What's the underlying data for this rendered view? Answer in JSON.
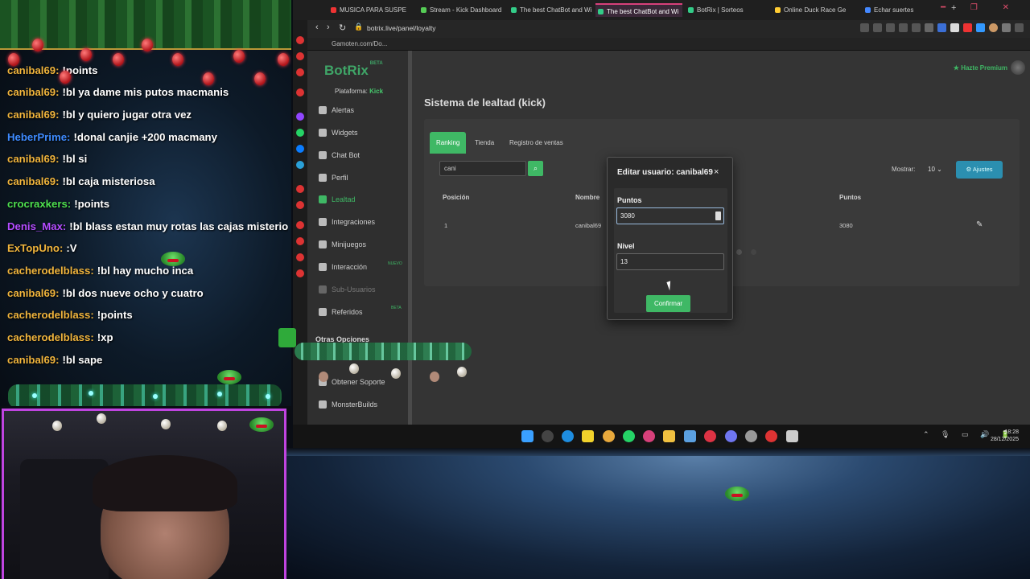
{
  "chat": {
    "lines": [
      {
        "user": "",
        "text": "",
        "color": "#ff5c5c"
      },
      {
        "user": "canibal69:",
        "text": "!points",
        "color": "#f0b43c"
      },
      {
        "user": "canibal69:",
        "text": "!bl ya dame mis putos macmanis",
        "color": "#f0b43c"
      },
      {
        "user": "canibal69:",
        "text": "!bl y quiero jugar otra vez",
        "color": "#f0b43c"
      },
      {
        "user": "HeberPrime:",
        "text": "!donal canjie +200 macmany",
        "color": "#3e8bff"
      },
      {
        "user": "canibal69:",
        "text": "!bl si",
        "color": "#f0b43c"
      },
      {
        "user": "canibal69:",
        "text": "!bl caja misteriosa",
        "color": "#f0b43c"
      },
      {
        "user": "crocraxkers:",
        "text": "!points",
        "color": "#4ee04e"
      },
      {
        "user": "Denis_Max:",
        "text": "!bl blass estan muy rotas las cajas misteriosas",
        "color": "#b44cff"
      },
      {
        "user": "ExTopUno:",
        "text": ":V",
        "color": "#f0b43c"
      },
      {
        "user": "cacherodelblass:",
        "text": "!bl hay mucho inca",
        "color": "#f0b43c"
      },
      {
        "user": "canibal69:",
        "text": "!bl dos nueve ocho y cuatro",
        "color": "#f0b43c"
      },
      {
        "user": "cacherodelblass:",
        "text": "!points",
        "color": "#f0b43c"
      },
      {
        "user": "cacherodelblass:",
        "text": "!xp",
        "color": "#f0b43c"
      },
      {
        "user": "canibal69:",
        "text": "!bl sape",
        "color": "#f0b43c"
      }
    ]
  },
  "browser": {
    "tabs": [
      {
        "label": "MUSICA PARA SUSPE",
        "icon_color": "#e33"
      },
      {
        "label": "Stream - Kick Dashboard",
        "icon_color": "#5c5"
      },
      {
        "label": "The best ChatBot and Wi",
        "icon_color": "#3c8"
      },
      {
        "label": "The best ChatBot and Wi",
        "icon_color": "#3c8"
      },
      {
        "label": "BotRix | Sorteos",
        "icon_color": "#3c8"
      },
      {
        "label": "Online Duck Race Ge",
        "icon_color": "#fc3"
      },
      {
        "label": "Echar suertes",
        "icon_color": "#48f"
      }
    ],
    "new_tab": "+",
    "window_controls": "━ ❐ ✕",
    "url": "botrix.live/panel/loyalty",
    "bookmark": "Gamoten.com/Do...",
    "nav_back": "‹",
    "nav_forward": "›",
    "nav_reload": "↻"
  },
  "app": {
    "logo": "BotRix",
    "logo_tag": "BETA",
    "platform_label": "Plataforma:",
    "platform_value": "Kick",
    "premium": "★ Hazte Premium",
    "nav": [
      {
        "label": "Alertas",
        "state": "normal"
      },
      {
        "label": "Widgets",
        "state": "normal"
      },
      {
        "label": "Chat Bot",
        "state": "normal"
      },
      {
        "label": "Perfil",
        "state": "normal"
      },
      {
        "label": "Lealtad",
        "state": "active"
      },
      {
        "label": "Integraciones",
        "state": "normal"
      },
      {
        "label": "Minijuegos",
        "state": "normal"
      },
      {
        "label": "Interacción",
        "state": "normal"
      },
      {
        "label": "Sub-Usuarios",
        "state": "dim"
      },
      {
        "label": "Referidos",
        "state": "normal"
      }
    ],
    "nav_badges": {
      "interaccion": "NUEVO",
      "referidos": "BETA"
    },
    "other_options_title": "Otras Opciones",
    "other_nav": [
      {
        "label": "Obtener Soporte"
      },
      {
        "label": "MonsterBuilds"
      }
    ],
    "page_title": "Sistema de lealtad (kick)",
    "tabs": [
      "Ranking",
      "Tienda",
      "Registro de ventas"
    ],
    "search_value": "cani",
    "show_label": "Mostrar:",
    "show_value": "10",
    "settings_button": "Ajustes",
    "table": {
      "headers": [
        "Posición",
        "Nombre",
        "Puntos"
      ],
      "rows": [
        {
          "position": "1",
          "name": "canibal69",
          "points": "3080"
        }
      ]
    }
  },
  "modal": {
    "title": "Editar usuario: canibal69",
    "close": "×",
    "points_label": "Puntos",
    "points_value": "3080",
    "level_label": "Nivel",
    "level_value": "13",
    "confirm": "Confirmar"
  },
  "taskbar": {
    "time": "18:28",
    "date": "28/12/2025",
    "tray_icons": "⌃ 🎙 ▭ 🔊 🔋"
  }
}
